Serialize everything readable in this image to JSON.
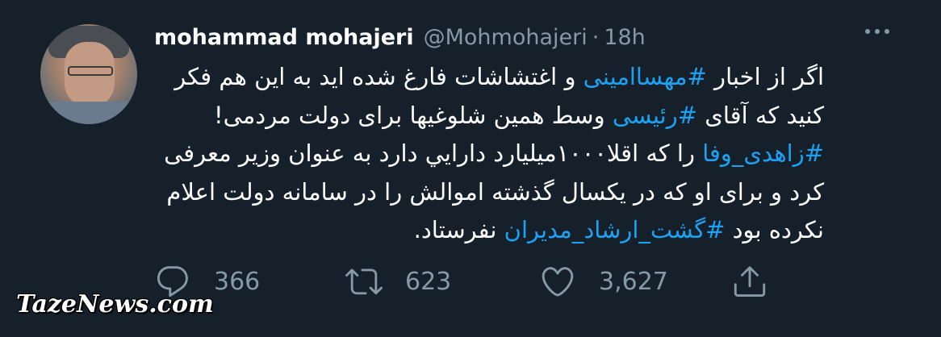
{
  "tweet": {
    "author_name": "mohammad mohajeri",
    "author_handle": "@Mohmohajeri",
    "separator": "·",
    "time": "18h",
    "lines": [
      [
        {
          "t": "اگر از اخبار "
        },
        {
          "t": "#مهساامینی",
          "tag": true
        },
        {
          "t": " و اغتشاشات فارغ شده اید به این هم فکر"
        }
      ],
      [
        {
          "t": "کنید که آقای "
        },
        {
          "t": "#رئیسی",
          "tag": true
        },
        {
          "t": " وسط همین شلوغیها برای دولت مردمی!"
        }
      ],
      [
        {
          "t": "#زاهدی_وفا",
          "tag": true
        },
        {
          "t": " را که اقلا۱۰۰۰میلیارد دارايي دارد به عنوان وزیر معرفی"
        }
      ],
      [
        {
          "t": "کرد و برای او که در یکسال گذشته اموالش را در سامانه دولت اعلام"
        }
      ],
      [
        {
          "t": "نکرده بود "
        },
        {
          "t": "#گشت_ارشاد_مدیران",
          "tag": true
        },
        {
          "t": " نفرستاد."
        }
      ]
    ]
  },
  "actions": {
    "reply_count": "366",
    "retweet_count": "623",
    "like_count": "3,627"
  },
  "icons": {
    "reply": "reply-icon",
    "retweet": "retweet-icon",
    "like": "like-icon",
    "share": "share-icon",
    "more": "more-icon"
  },
  "colors": {
    "background": "#15202b",
    "hashtag": "#1da1f2",
    "muted": "#8899a6"
  },
  "watermark": "TazeNews.com"
}
